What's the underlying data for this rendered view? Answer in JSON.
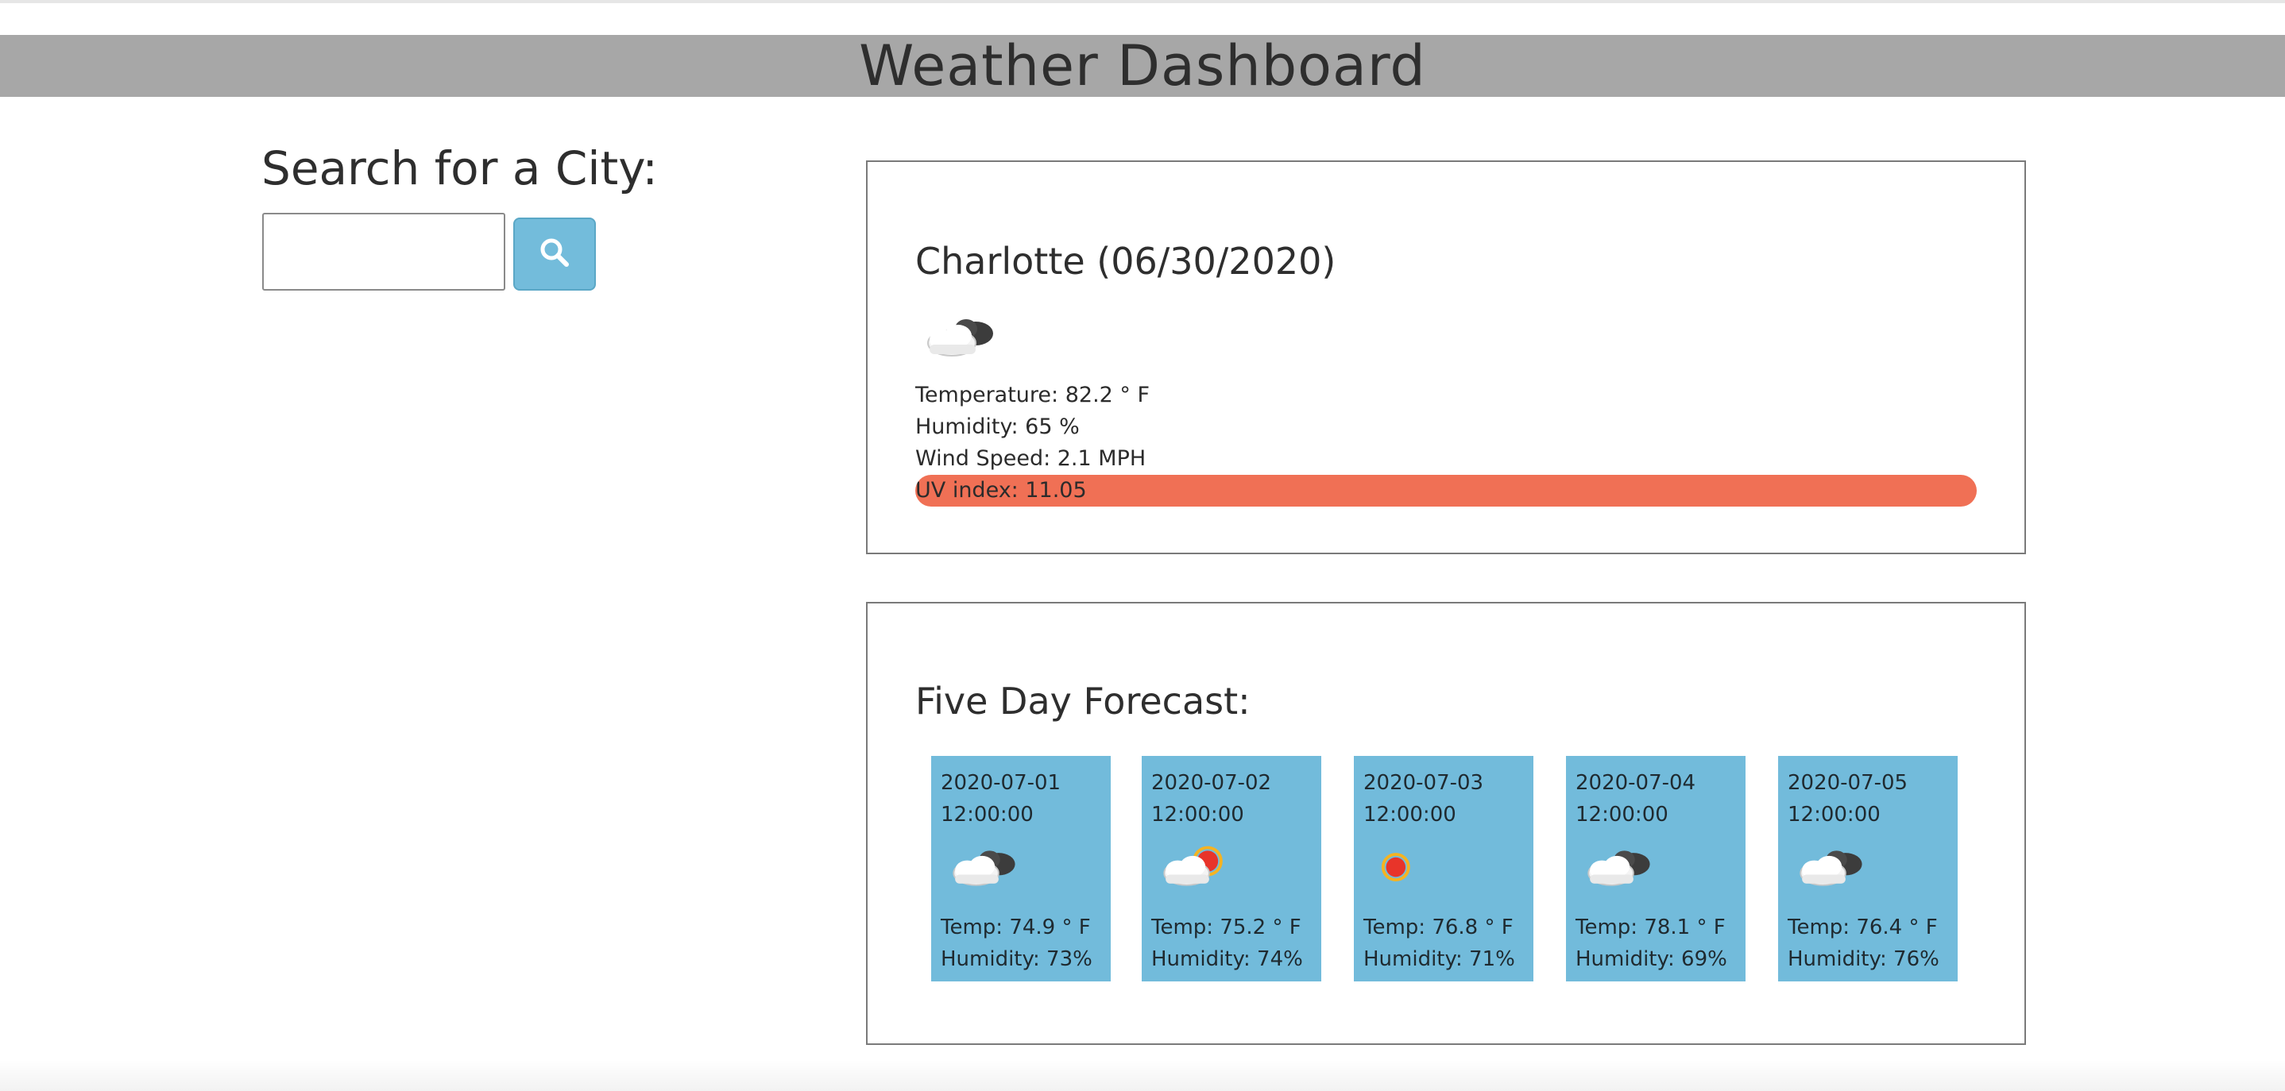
{
  "header": {
    "title": "Weather Dashboard"
  },
  "search": {
    "title": "Search for a City:",
    "input_value": "",
    "placeholder": "",
    "button_icon": "search-icon"
  },
  "current": {
    "city_date": "Charlotte (06/30/2020)",
    "icon": "partly-cloudy-icon",
    "temperature": "Temperature: 82.2 ° F",
    "humidity": "Humidity: 65 %",
    "wind": "Wind Speed: 2.1 MPH",
    "uv": "UV index: 11.05",
    "uv_color": "#f07055"
  },
  "forecast": {
    "title": "Five Day Forecast:",
    "card_color": "#72bbdb",
    "days": [
      {
        "date": "2020-07-01 12:00:00",
        "icon": "cloudy-icon",
        "temp": "Temp: 74.9 ° F",
        "humidity": "Humidity: 73%"
      },
      {
        "date": "2020-07-02 12:00:00",
        "icon": "partly-sunny-icon",
        "temp": "Temp: 75.2 ° F",
        "humidity": "Humidity: 74%"
      },
      {
        "date": "2020-07-03 12:00:00",
        "icon": "sun-icon",
        "temp": "Temp: 76.8 ° F",
        "humidity": "Humidity: 71%"
      },
      {
        "date": "2020-07-04 12:00:00",
        "icon": "cloudy-icon",
        "temp": "Temp: 78.1 ° F",
        "humidity": "Humidity: 69%"
      },
      {
        "date": "2020-07-05 12:00:00",
        "icon": "cloudy-icon",
        "temp": "Temp: 76.4 ° F",
        "humidity": "Humidity: 76%"
      }
    ]
  }
}
